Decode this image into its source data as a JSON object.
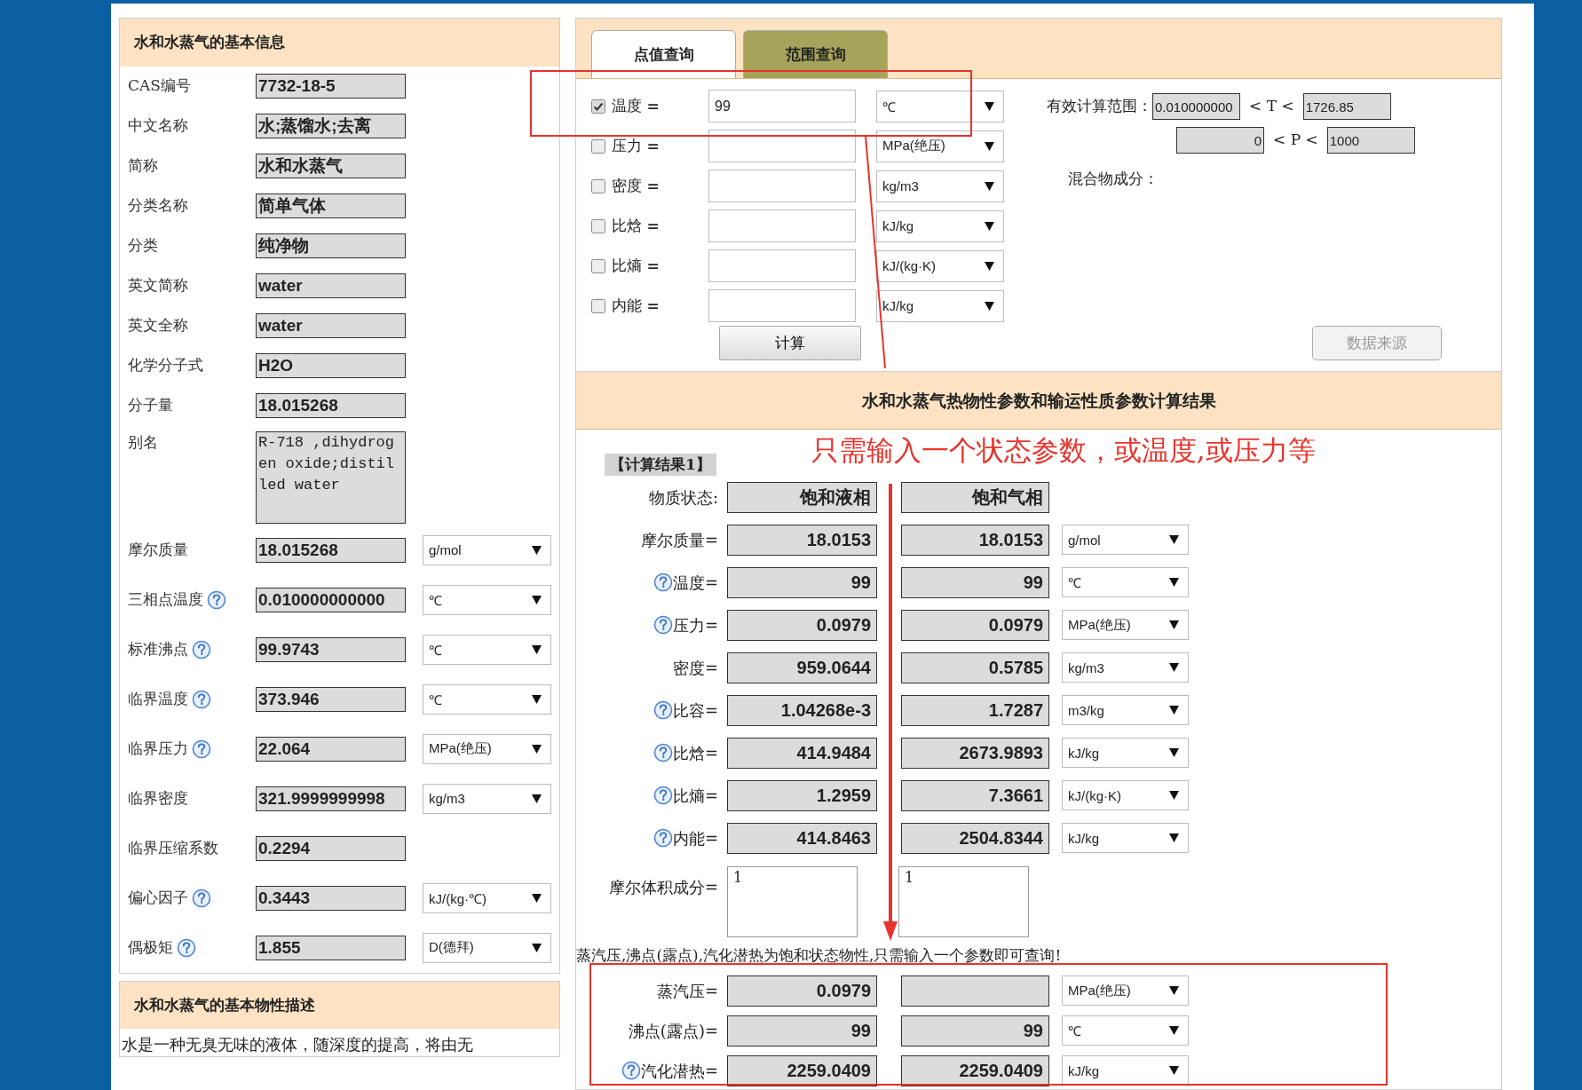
{
  "basic_info": {
    "title": "水和水蒸气的基本信息",
    "rows": [
      {
        "kind": "text",
        "label": "CAS编号",
        "value": "7732-18-5",
        "help": false
      },
      {
        "kind": "text",
        "label": "中文名称",
        "value": "水;蒸馏水;去离",
        "help": false
      },
      {
        "kind": "text",
        "label": "简称",
        "value": "水和水蒸气",
        "help": false
      },
      {
        "kind": "text",
        "label": "分类名称",
        "value": "简单气体",
        "help": false
      },
      {
        "kind": "text",
        "label": "分类",
        "value": "纯净物",
        "help": false
      },
      {
        "kind": "text",
        "label": "英文简称",
        "value": "water",
        "help": false
      },
      {
        "kind": "text",
        "label": "英文全称",
        "value": "water",
        "help": false
      },
      {
        "kind": "text",
        "label": "化学分子式",
        "value": "H2O",
        "help": false
      },
      {
        "kind": "text",
        "label": "分子量",
        "value": "18.015268",
        "help": false
      },
      {
        "kind": "multiline",
        "label": "别名",
        "value": "R-718 ,dihydrogen oxide;distilled water",
        "help": false
      },
      {
        "kind": "measure",
        "label": "摩尔质量",
        "value": "18.015268",
        "unit": "g/mol",
        "help": false
      },
      {
        "kind": "measure",
        "label": "三相点温度",
        "value": "0.010000000000",
        "unit": "℃",
        "help": true
      },
      {
        "kind": "measure",
        "label": "标准沸点",
        "value": "99.9743",
        "unit": "℃",
        "help": true
      },
      {
        "kind": "measure",
        "label": "临界温度",
        "value": "373.946",
        "unit": "℃",
        "help": true
      },
      {
        "kind": "measure",
        "label": "临界压力",
        "value": "22.064",
        "unit": "MPa(绝压)",
        "help": true
      },
      {
        "kind": "measure",
        "label": "临界密度",
        "value": "321.9999999998",
        "unit": "kg/m3",
        "help": false
      },
      {
        "kind": "measure",
        "label": "临界压缩系数",
        "value": "0.2294",
        "help": false
      },
      {
        "kind": "measure",
        "label": "偏心因子",
        "value": "0.3443",
        "unit": "kJ/(kg·℃)",
        "help": true
      },
      {
        "kind": "measure",
        "label": "偶极矩",
        "value": "1.855",
        "unit": "D(德拜)",
        "help": true
      }
    ]
  },
  "description": {
    "title": "水和水蒸气的基本物性描述",
    "text": "水是一种无臭无味的液体，随深度的提高，将由无"
  },
  "query": {
    "tabs": [
      {
        "label": "点值查询",
        "selected": true
      },
      {
        "label": "范围查询",
        "selected": false
      }
    ],
    "inputs": [
      {
        "label": "温度 **=**",
        "checked": true,
        "value": "99",
        "unit": "℃"
      },
      {
        "label": "压力 **=**",
        "checked": false,
        "unit": "MPa(绝压)"
      },
      {
        "label": "密度 **=**",
        "checked": false,
        "unit": "kg/m3"
      },
      {
        "label": "比焓 **=**",
        "checked": false,
        "unit": "kJ/kg"
      },
      {
        "label": "比熵 **=**",
        "checked": false,
        "unit": "kJ/(kg·K)"
      },
      {
        "label": "内能 **=**",
        "checked": false,
        "unit": "kJ/kg"
      }
    ],
    "range_label": "有效计算范围：",
    "ranges": [
      {
        "min": "0.010000000",
        "symbol": "< T <",
        "max": "1726.85"
      },
      {
        "min": "0",
        "symbol": "< P <",
        "max": "1000"
      }
    ],
    "mixture_label": "混合物成分：",
    "buttons": [
      {
        "label": "计算",
        "disabled": false
      },
      {
        "label": "数据来源",
        "disabled": true
      }
    ]
  },
  "result": {
    "title": "水和水蒸气热物性参数和输运性质参数计算结果",
    "annotation": "只需输入一个状态参数，或温度,或压力等",
    "badge": "【计算结果1】",
    "phase_label": "物质状态:",
    "phases": [
      "饱和液相",
      "饱和气相"
    ],
    "rows": [
      {
        "label": "摩尔质量=",
        "help": false,
        "liquid": "18.0153",
        "vapor": "18.0153",
        "unit": "g/mol"
      },
      {
        "label": "温度=",
        "help": true,
        "liquid": "99",
        "vapor": "99",
        "unit": "℃"
      },
      {
        "label": "压力=",
        "help": true,
        "liquid": "0.0979",
        "vapor": "0.0979",
        "unit": "MPa(绝压)"
      },
      {
        "label": "密度=",
        "help": false,
        "liquid": "959.0644",
        "vapor": "0.5785",
        "unit": "kg/m3"
      },
      {
        "label": "比容=",
        "help": true,
        "liquid": "1.04268e-3",
        "vapor": "1.7287",
        "unit": "m3/kg"
      },
      {
        "label": "比焓=",
        "help": true,
        "liquid": "414.9484",
        "vapor": "2673.9893",
        "unit": "kJ/kg"
      },
      {
        "label": "比熵=",
        "help": true,
        "liquid": "1.2959",
        "vapor": "7.3661",
        "unit": "kJ/(kg·K)"
      },
      {
        "label": "内能=",
        "help": true,
        "liquid": "414.8463",
        "vapor": "2504.8344",
        "unit": "kJ/kg"
      }
    ],
    "fraction": {
      "label": "摩尔体积成分=",
      "liquid": "1",
      "vapor": "1"
    },
    "note": "蒸汽压,沸点(露点),汽化潜热为饱和状态物性,只需输入一个参数即可查询!",
    "saturation_rows": [
      {
        "label": "蒸汽压=",
        "help": false,
        "liquid": "0.0979",
        "unit": "MPa(绝压)"
      },
      {
        "label": "沸点(露点)=",
        "help": false,
        "liquid": "99",
        "vapor": "99",
        "unit": "℃"
      },
      {
        "label": "汽化潜热=",
        "help": true,
        "liquid": "2259.0409",
        "vapor": "2259.0409",
        "unit": "kJ/kg"
      }
    ]
  }
}
